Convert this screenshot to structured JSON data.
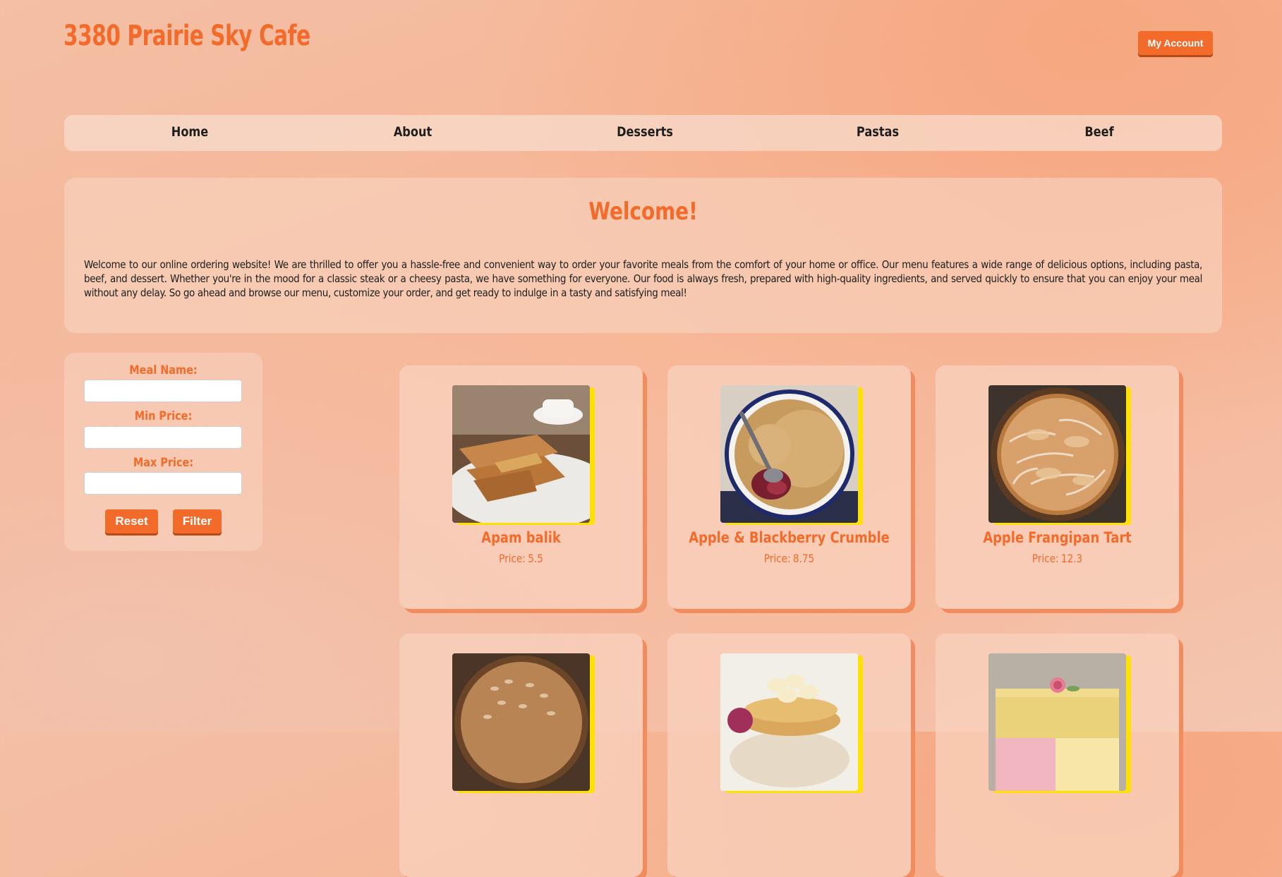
{
  "header": {
    "brand": "3380 Prairie Sky Cafe",
    "account_label": "My Account"
  },
  "nav": {
    "items": [
      {
        "label": "Home"
      },
      {
        "label": "About"
      },
      {
        "label": "Desserts"
      },
      {
        "label": "Pastas"
      },
      {
        "label": "Beef"
      }
    ]
  },
  "welcome": {
    "title": "Welcome!",
    "body": "Welcome to our online ordering website! We are thrilled to offer you a hassle-free and convenient way to order your favorite meals from the comfort of your home or office. Our menu features a wide range of delicious options, including pasta, beef, and dessert. Whether you're in the mood for a classic steak or a cheesy pasta, we have something for everyone. Our food is always fresh, prepared with high-quality ingredients, and served quickly to ensure that you can enjoy your meal without any delay. So go ahead and browse our menu, customize your order, and get ready to indulge in a tasty and satisfying meal!"
  },
  "filter": {
    "meal_name_label": "Meal Name:",
    "meal_name_value": "",
    "min_price_label": "Min Price:",
    "min_price_value": "",
    "max_price_label": "Max Price:",
    "max_price_value": "",
    "reset_label": "Reset",
    "filter_label": "Filter"
  },
  "meals": [
    {
      "name": "Apam balik",
      "price_label": "Price:",
      "price": "5.5"
    },
    {
      "name": "Apple & Blackberry Crumble",
      "price_label": "Price:",
      "price": "8.75"
    },
    {
      "name": "Apple Frangipan Tart",
      "price_label": "Price:",
      "price": "12.3"
    },
    {
      "name": "",
      "price_label": "",
      "price": ""
    },
    {
      "name": "",
      "price_label": "",
      "price": ""
    },
    {
      "name": "",
      "price_label": "",
      "price": ""
    }
  ],
  "colors": {
    "accent": "#f36b2b",
    "image_accent": "#ffe100"
  }
}
